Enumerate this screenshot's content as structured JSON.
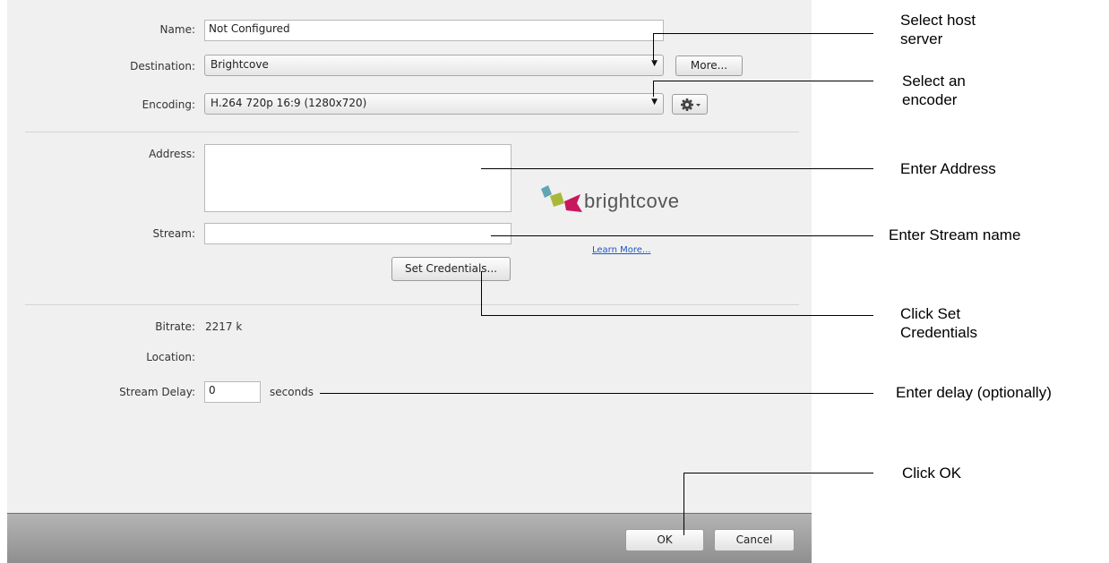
{
  "form": {
    "name_label": "Name:",
    "name_value": "Not Configured",
    "destination_label": "Destination:",
    "destination_value": "Brightcove",
    "more_button": "More...",
    "encoding_label": "Encoding:",
    "encoding_value": "H.264 720p 16:9 (1280x720)",
    "address_label": "Address:",
    "address_value": "",
    "stream_label": "Stream:",
    "stream_value": "",
    "set_credentials_button": "Set Credentials...",
    "learn_more_link": "Learn More...",
    "brand_name": "brightcove",
    "bitrate_label": "Bitrate:",
    "bitrate_value": "2217 k",
    "location_label": "Location:",
    "location_value": "",
    "stream_delay_label": "Stream Delay:",
    "stream_delay_value": "0",
    "seconds_label": "seconds"
  },
  "footer": {
    "ok_button": "OK",
    "cancel_button": "Cancel"
  },
  "callouts": {
    "select_host": [
      "Select host",
      "server"
    ],
    "select_encoder": [
      "Select an",
      "encoder"
    ],
    "enter_address": "Enter Address",
    "enter_stream": "Enter Stream name",
    "click_credentials": [
      "Click Set",
      "Credentials"
    ],
    "enter_delay": "Enter delay (optionally)",
    "click_ok": "Click OK"
  },
  "icons": {
    "dropdown_arrow": "chevron-down-icon",
    "settings": "gear-icon",
    "logo": "brightcove-logo"
  }
}
